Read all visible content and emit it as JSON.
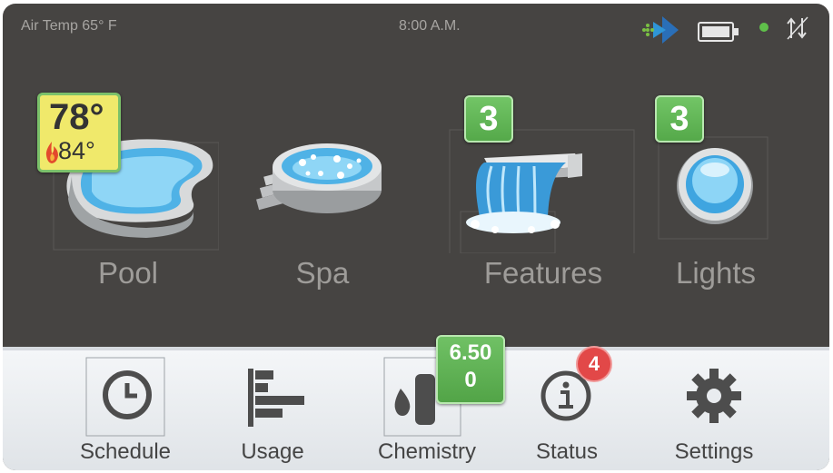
{
  "status_bar": {
    "air_temp": "Air Temp 65° F",
    "time": "8:00 A.M."
  },
  "tiles": {
    "pool": {
      "label": "Pool",
      "temp": "78°",
      "setpoint": "84°",
      "heater_on": true
    },
    "spa": {
      "label": "Spa"
    },
    "features": {
      "label": "Features",
      "count": "3"
    },
    "lights": {
      "label": "Lights",
      "count": "3"
    }
  },
  "nav": {
    "schedule": {
      "label": "Schedule",
      "icon": "clock-icon"
    },
    "usage": {
      "label": "Usage",
      "icon": "bar-chart-icon"
    },
    "chemistry": {
      "label": "Chemistry",
      "icon": "thermometer-drop-icon",
      "ph": "6.50",
      "orp": "0"
    },
    "status": {
      "label": "Status",
      "icon": "info-icon",
      "alerts": "4"
    },
    "settings": {
      "label": "Settings",
      "icon": "gear-icon"
    }
  },
  "colors": {
    "panel": "#464442",
    "badge_green": "#5cb551",
    "temp_yellow": "#f0e96b",
    "alert_red": "#e24848",
    "online_green": "#5fc04a"
  }
}
